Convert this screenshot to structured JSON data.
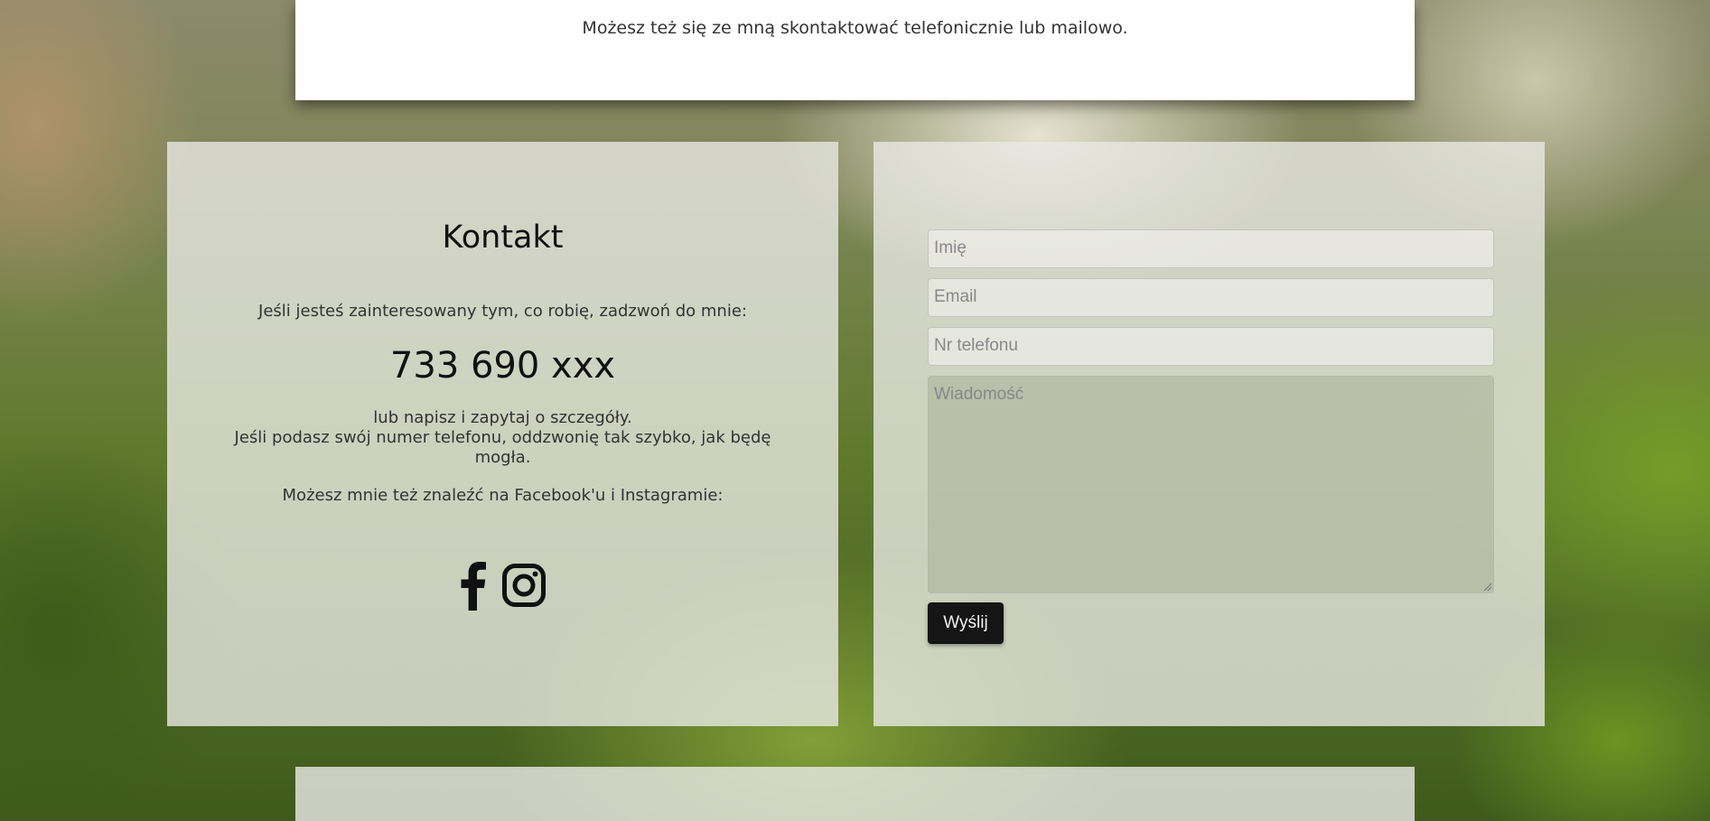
{
  "top_section": {
    "text": "Możesz też się ze mną skontaktować telefonicznie lub mailowo."
  },
  "contact": {
    "title": "Kontakt",
    "intro": "Jeśli jesteś zainteresowany tym, co robię, zadzwoń do mnie:",
    "phone": "733 690 xxx",
    "details_line1": "lub napisz i zapytaj o szczegóły.",
    "details_line2": "Jeśli podasz swój numer telefonu, oddzwonię tak szybko, jak będę mogła.",
    "social_text": "Możesz mnie też znaleźć na Facebook'u i Instagramie:",
    "social_icons": [
      "facebook-icon",
      "instagram-icon"
    ]
  },
  "form": {
    "name_placeholder": "Imię",
    "email_placeholder": "Email",
    "phone_placeholder": "Nr telefonu",
    "message_placeholder": "Wiadomość",
    "submit_label": "Wyślij"
  },
  "colors": {
    "button_bg": "#151515",
    "panel_bg": "#e8e8e4",
    "text": "#333333"
  }
}
